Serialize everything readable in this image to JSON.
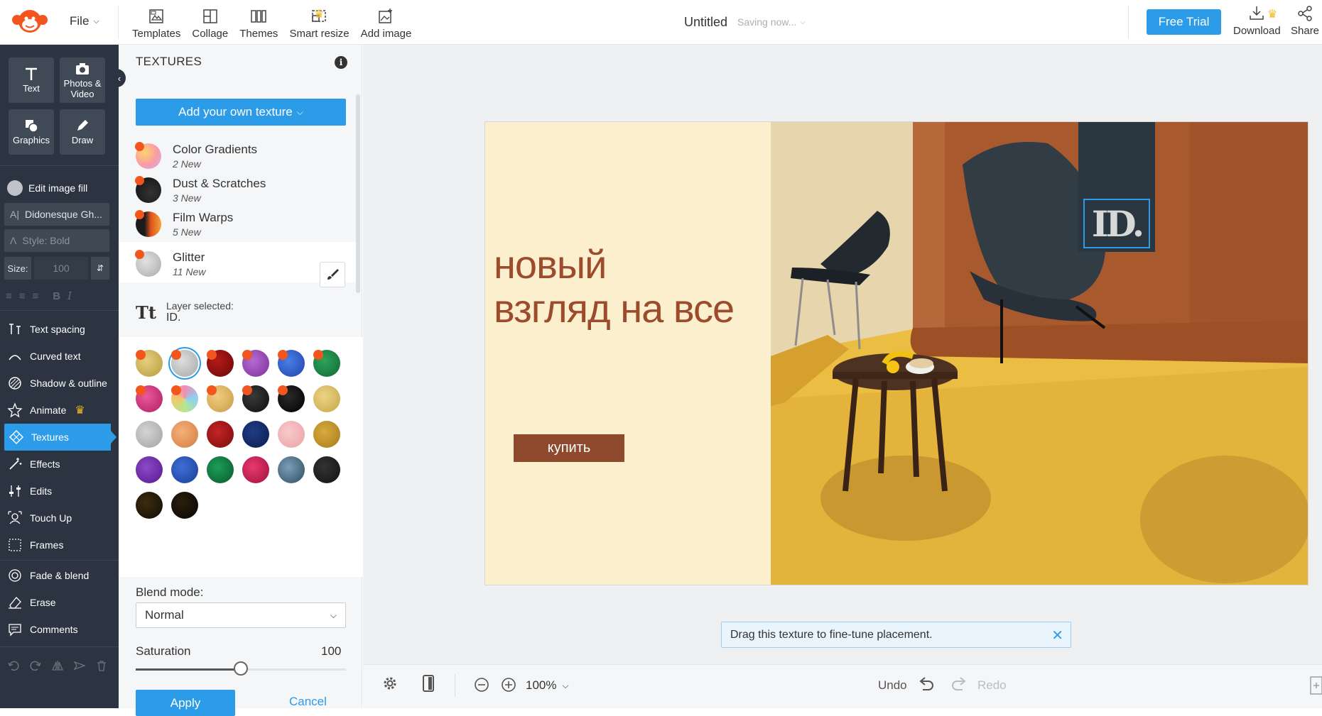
{
  "topbar": {
    "file": "File",
    "tools": [
      {
        "label": "Templates",
        "icon": "templates-icon"
      },
      {
        "label": "Collage",
        "icon": "collage-icon"
      },
      {
        "label": "Themes",
        "icon": "themes-icon"
      },
      {
        "label": "Smart resize",
        "icon": "smart-resize-icon"
      },
      {
        "label": "Add image",
        "icon": "add-image-icon"
      }
    ],
    "title": "Untitled",
    "saving": "Saving now...",
    "free_trial": "Free Trial",
    "download": "Download",
    "share": "Share"
  },
  "leftnav": {
    "big_tools": [
      "Text",
      "Photos & Video",
      "Graphics",
      "Draw"
    ],
    "edit_fill": "Edit image fill",
    "font": "Didonesque Gh...",
    "style": "Style: Bold",
    "size_label": "Size:",
    "size_value": "100",
    "items": [
      {
        "label": "Text spacing",
        "icon": "text-spacing-icon"
      },
      {
        "label": "Curved text",
        "icon": "curved-text-icon"
      },
      {
        "label": "Shadow & outline",
        "icon": "shadow-outline-icon"
      },
      {
        "label": "Animate",
        "icon": "animate-icon"
      },
      {
        "label": "Textures",
        "icon": "textures-icon"
      },
      {
        "label": "Effects",
        "icon": "effects-icon"
      },
      {
        "label": "Edits",
        "icon": "edits-icon"
      },
      {
        "label": "Touch Up",
        "icon": "touch-up-icon"
      },
      {
        "label": "Frames",
        "icon": "frames-icon"
      },
      {
        "label": "Fade & blend",
        "icon": "fade-blend-icon"
      },
      {
        "label": "Erase",
        "icon": "erase-icon"
      },
      {
        "label": "Comments",
        "icon": "comments-icon"
      }
    ]
  },
  "panel": {
    "title": "TEXTURES",
    "add_texture": "Add your own texture",
    "categories": [
      {
        "name": "Color Gradients",
        "new": "2 New"
      },
      {
        "name": "Dust & Scratches",
        "new": "3 New"
      },
      {
        "name": "Film Warps",
        "new": "5 New"
      },
      {
        "name": "Glitter",
        "new": "11 New"
      }
    ],
    "layer_label": "Layer selected:",
    "layer_value": "ID.",
    "tt": "Tt",
    "blend_label": "Blend mode:",
    "blend_value": "Normal",
    "saturation_label": "Saturation",
    "saturation_value": "100",
    "saturation_fraction": 0.5,
    "apply": "Apply",
    "cancel": "Cancel"
  },
  "canvas": {
    "headline_line1": "новый",
    "headline_line2": "взгляд на все",
    "button": "купить",
    "logo": "ID."
  },
  "toast": "Drag this texture to fine-tune placement.",
  "bottom": {
    "zoom": "100%",
    "undo": "Undo",
    "redo": "Redo"
  },
  "colors": {
    "accent": "#2c9be8",
    "nav_bg": "#2b3440",
    "new_dot": "#f2561d",
    "headline": "#9c4b2c",
    "canvas_bg": "#fcefcd"
  }
}
